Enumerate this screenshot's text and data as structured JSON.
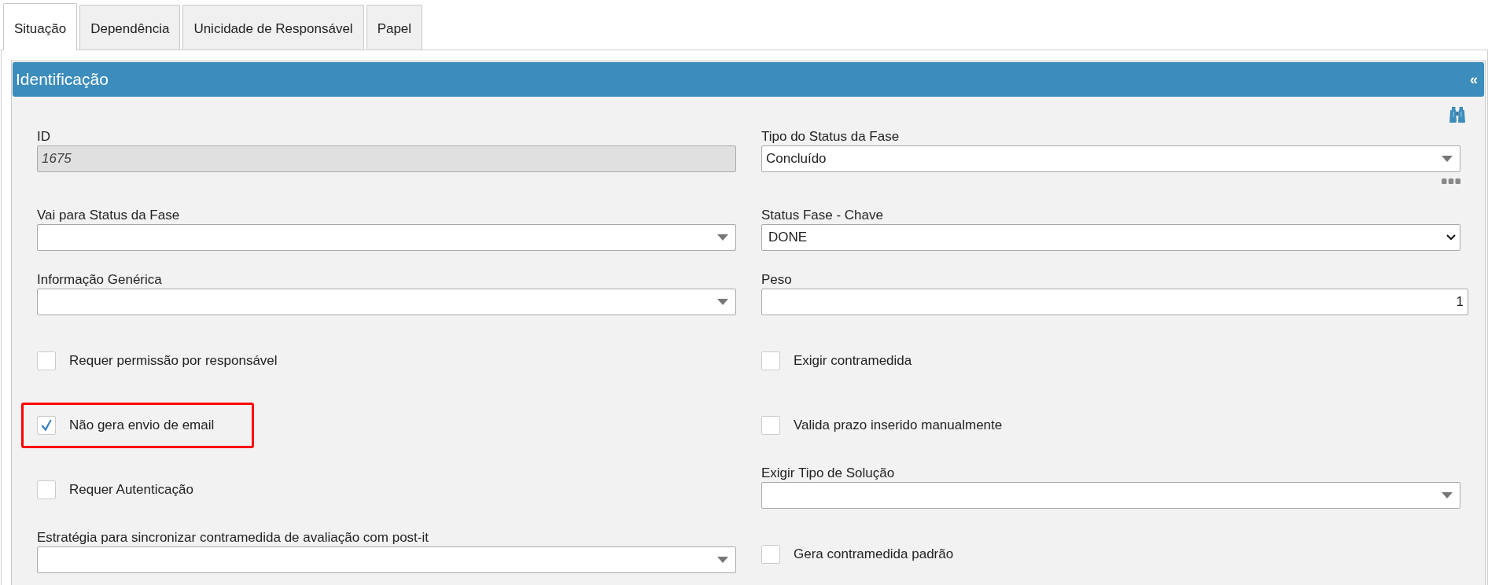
{
  "tabs": [
    {
      "label": "Situação",
      "selected": true
    },
    {
      "label": "Dependência",
      "selected": false
    },
    {
      "label": "Unicidade de Responsável",
      "selected": false
    },
    {
      "label": "Papel",
      "selected": false
    }
  ],
  "panel": {
    "title": "Identificação",
    "collapse_glyph": "«",
    "rows": [
      {
        "cells": [
          {
            "kind": "text",
            "label": "ID",
            "value": "1675",
            "disabled": true,
            "highlighted": false
          },
          {
            "kind": "lookup",
            "label": "Tipo do Status da Fase",
            "value": "Concluído",
            "disabled": false,
            "highlighted": false
          }
        ]
      },
      {
        "cells": [
          {
            "kind": "select",
            "label": "Vai para Status da Fase",
            "disabled": false,
            "highlighted": false
          },
          {
            "kind": "native_select",
            "label": "Status Fase - Chave",
            "value": "DONE",
            "disabled": false,
            "highlighted": false
          }
        ]
      },
      {
        "cells": [
          {
            "kind": "select",
            "label": "Informação Genérica",
            "disabled": false,
            "highlighted": false
          },
          {
            "kind": "number",
            "label": "Peso",
            "value": "1",
            "disabled": false,
            "highlighted": false
          }
        ]
      },
      {
        "cells": [
          {
            "kind": "checkbox",
            "label": "Requer permissão por responsável",
            "checked": false,
            "disabled": false,
            "highlighted": false
          },
          {
            "kind": "checkbox",
            "label": "Exigir contramedida",
            "checked": false,
            "disabled": false,
            "highlighted": false
          }
        ]
      },
      {
        "cells": [
          {
            "kind": "checkbox",
            "label": "Não gera envio de email",
            "checked": true,
            "disabled": false,
            "highlighted": true
          },
          {
            "kind": "checkbox",
            "label": "Valida prazo inserido manualmente",
            "checked": false,
            "disabled": false,
            "highlighted": false
          }
        ]
      },
      {
        "cells": [
          {
            "kind": "checkbox",
            "label": "Requer Autenticação",
            "checked": false,
            "disabled": false,
            "highlighted": false
          },
          {
            "kind": "select",
            "label": "Exigir Tipo de Solução",
            "disabled": false,
            "highlighted": false
          }
        ]
      },
      {
        "cells": [
          {
            "kind": "select",
            "label": "Estratégia para sincronizar contramedida de avaliação com post-it",
            "disabled": false,
            "highlighted": false
          },
          {
            "kind": "checkbox",
            "label": "Gera contramedida padrão",
            "checked": false,
            "disabled": false,
            "highlighted": false
          }
        ]
      }
    ]
  }
}
